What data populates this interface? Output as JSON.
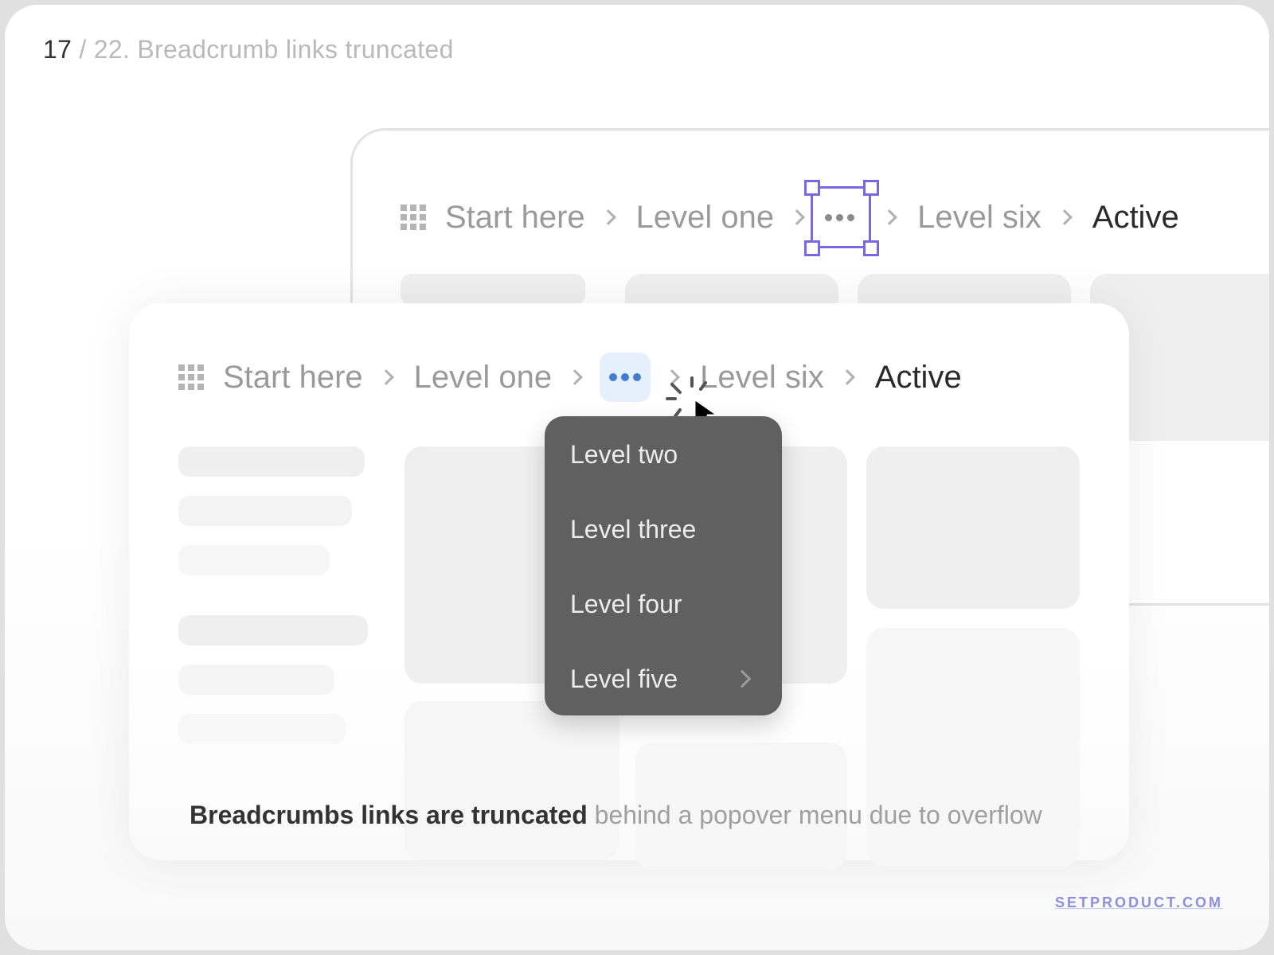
{
  "header": {
    "slide_number": "17",
    "slide_total_and_title": " / 22. Breadcrumb links truncated"
  },
  "back_breadcrumb": {
    "items": [
      {
        "label": "Start here"
      },
      {
        "label": "Level one"
      },
      {
        "label": "Level six"
      },
      {
        "label": "Active"
      }
    ],
    "overflow_icon": "more-horizontal-icon",
    "selection_color": "#7a68e0"
  },
  "front_breadcrumb": {
    "items": [
      {
        "label": "Start here"
      },
      {
        "label": "Level one"
      },
      {
        "label": "Level six"
      },
      {
        "label": "Active"
      }
    ],
    "overflow_icon": "more-horizontal-icon",
    "overflow_accent": "#3f7dd0"
  },
  "popover_menu": {
    "items": [
      {
        "label": "Level two",
        "has_submenu": false
      },
      {
        "label": "Level three",
        "has_submenu": false
      },
      {
        "label": "Level four",
        "has_submenu": false
      },
      {
        "label": "Level five",
        "has_submenu": true
      }
    ]
  },
  "caption": {
    "bold": "Breadcrumbs links are truncated",
    "rest": " behind a popover menu due to overflow"
  },
  "brand": {
    "label": "SETPRODUCT.COM",
    "color": "#8b8fdc"
  }
}
